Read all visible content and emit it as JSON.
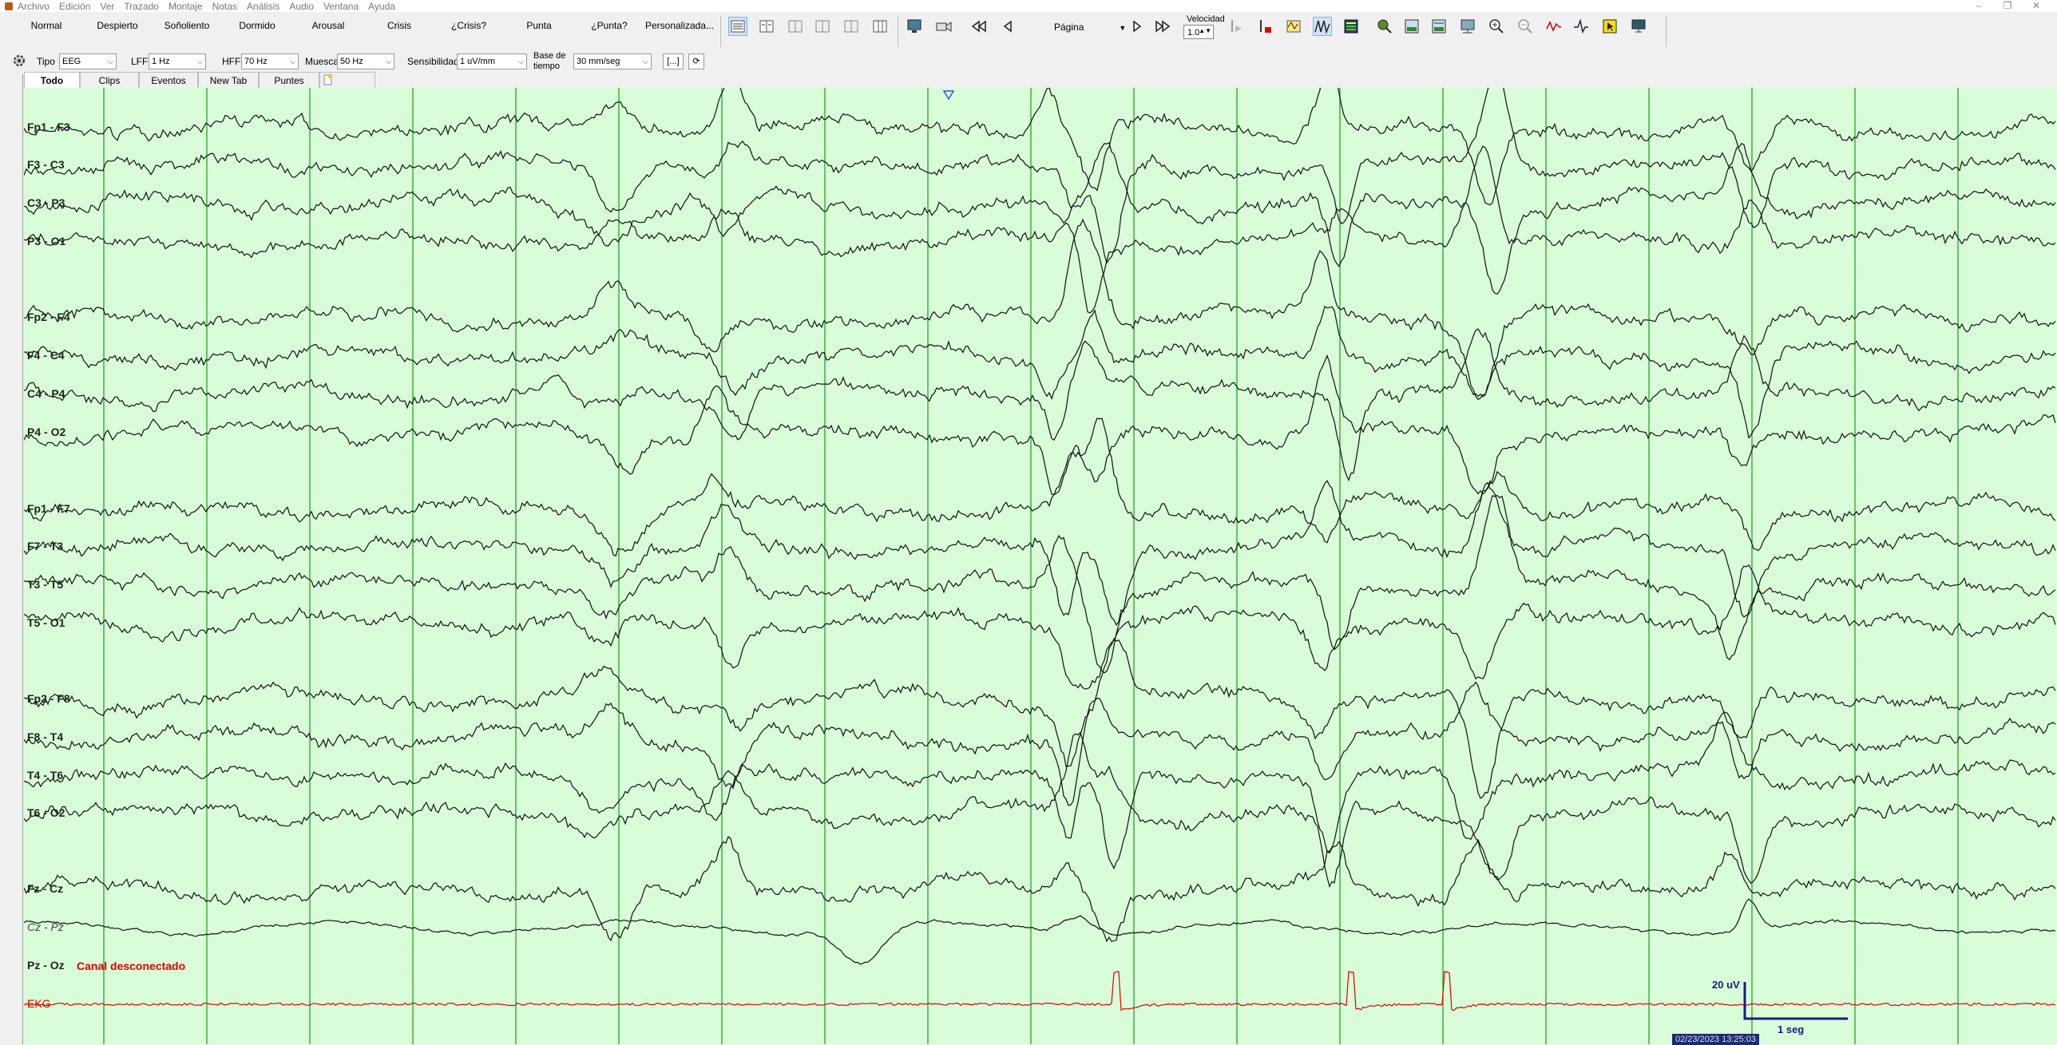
{
  "menu": [
    "Archivo",
    "Edición",
    "Ver",
    "Trazado",
    "Montaje",
    "Notas",
    "Análisis",
    "Audio",
    "Ventana",
    "Ayuda"
  ],
  "state_buttons": [
    "Normal",
    "Despierto",
    "Soñoliento",
    "Dormido",
    "Arousal",
    "Crisis",
    "¿Crisis?",
    "Punta",
    "¿Punta?",
    "Personalizada..."
  ],
  "toolbar": {
    "page_label": "Página",
    "speed_label": "Velocidad",
    "speed_value": "1.0"
  },
  "filters": {
    "type_label": "Tipo",
    "type_value": "EEG",
    "lff_label": "LFF",
    "lff_value": "1 Hz",
    "hff_label": "HFF",
    "hff_value": "70 Hz",
    "notch_label": "Muesca",
    "notch_value": "50 Hz",
    "sens_label": "Sensibilidad",
    "sens_value": "1 uV/mm",
    "base_label_1": "Base de",
    "base_label_2": "tiempo",
    "base_value": "30 mm/seg",
    "bracket_btn": "[...]"
  },
  "tabs": [
    "Todo",
    "Clips",
    "Eventos",
    "New Tab",
    "Puntes"
  ],
  "channels": [
    {
      "label": "Fp1 - F3",
      "style": "normal"
    },
    {
      "label": "F3 - C3",
      "style": "normal"
    },
    {
      "label": "C3 - P3",
      "style": "normal"
    },
    {
      "label": "P3 - O1",
      "style": "normal"
    },
    {
      "label": "Fp2 - F4",
      "style": "normal"
    },
    {
      "label": "F4 - C4",
      "style": "normal"
    },
    {
      "label": "C4 - P4",
      "style": "normal"
    },
    {
      "label": "P4 - O2",
      "style": "normal"
    },
    {
      "label": "Fp1 - F7",
      "style": "normal"
    },
    {
      "label": "F7 - T3",
      "style": "normal"
    },
    {
      "label": "T3 - T5",
      "style": "normal"
    },
    {
      "label": "T5 - O1",
      "style": "normal"
    },
    {
      "label": "Fp2 - F8",
      "style": "normal"
    },
    {
      "label": "F8 - T4",
      "style": "normal"
    },
    {
      "label": "T4 - T6",
      "style": "normal"
    },
    {
      "label": "T6 - O2",
      "style": "normal"
    },
    {
      "label": "Fz - Cz",
      "style": "normal"
    },
    {
      "label": "Cz - Pz",
      "style": "italic"
    },
    {
      "label": "Pz - Oz",
      "style": "normal"
    },
    {
      "label": "EKG",
      "style": "red"
    }
  ],
  "disconnected_text": "Canal desconectado",
  "scale": {
    "amplitude": "20 uV",
    "time": "1 seg"
  },
  "timestamp": "02/23/2023 13:25:03",
  "colors": {
    "background": "#d8fdd8",
    "grid": "#1a9a1a",
    "trace": "#111111",
    "ekg": "#e00000",
    "scale": "#1a1a80"
  }
}
